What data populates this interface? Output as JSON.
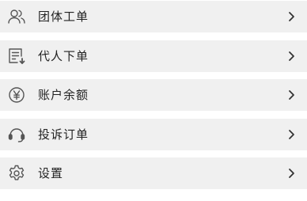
{
  "menu": {
    "items": [
      {
        "label": "团体工单",
        "icon": "group-users-icon"
      },
      {
        "label": "代人下单",
        "icon": "order-download-icon"
      },
      {
        "label": "账户余额",
        "icon": "yuan-balance-icon"
      },
      {
        "label": "投诉订单",
        "icon": "headset-icon"
      },
      {
        "label": "设置",
        "icon": "gear-icon"
      }
    ],
    "chevron": "chevron-right-icon"
  },
  "colors": {
    "row_background": "#f0f0f0",
    "page_background": "#ffffff",
    "text": "#222222",
    "icon_stroke": "#555555"
  }
}
